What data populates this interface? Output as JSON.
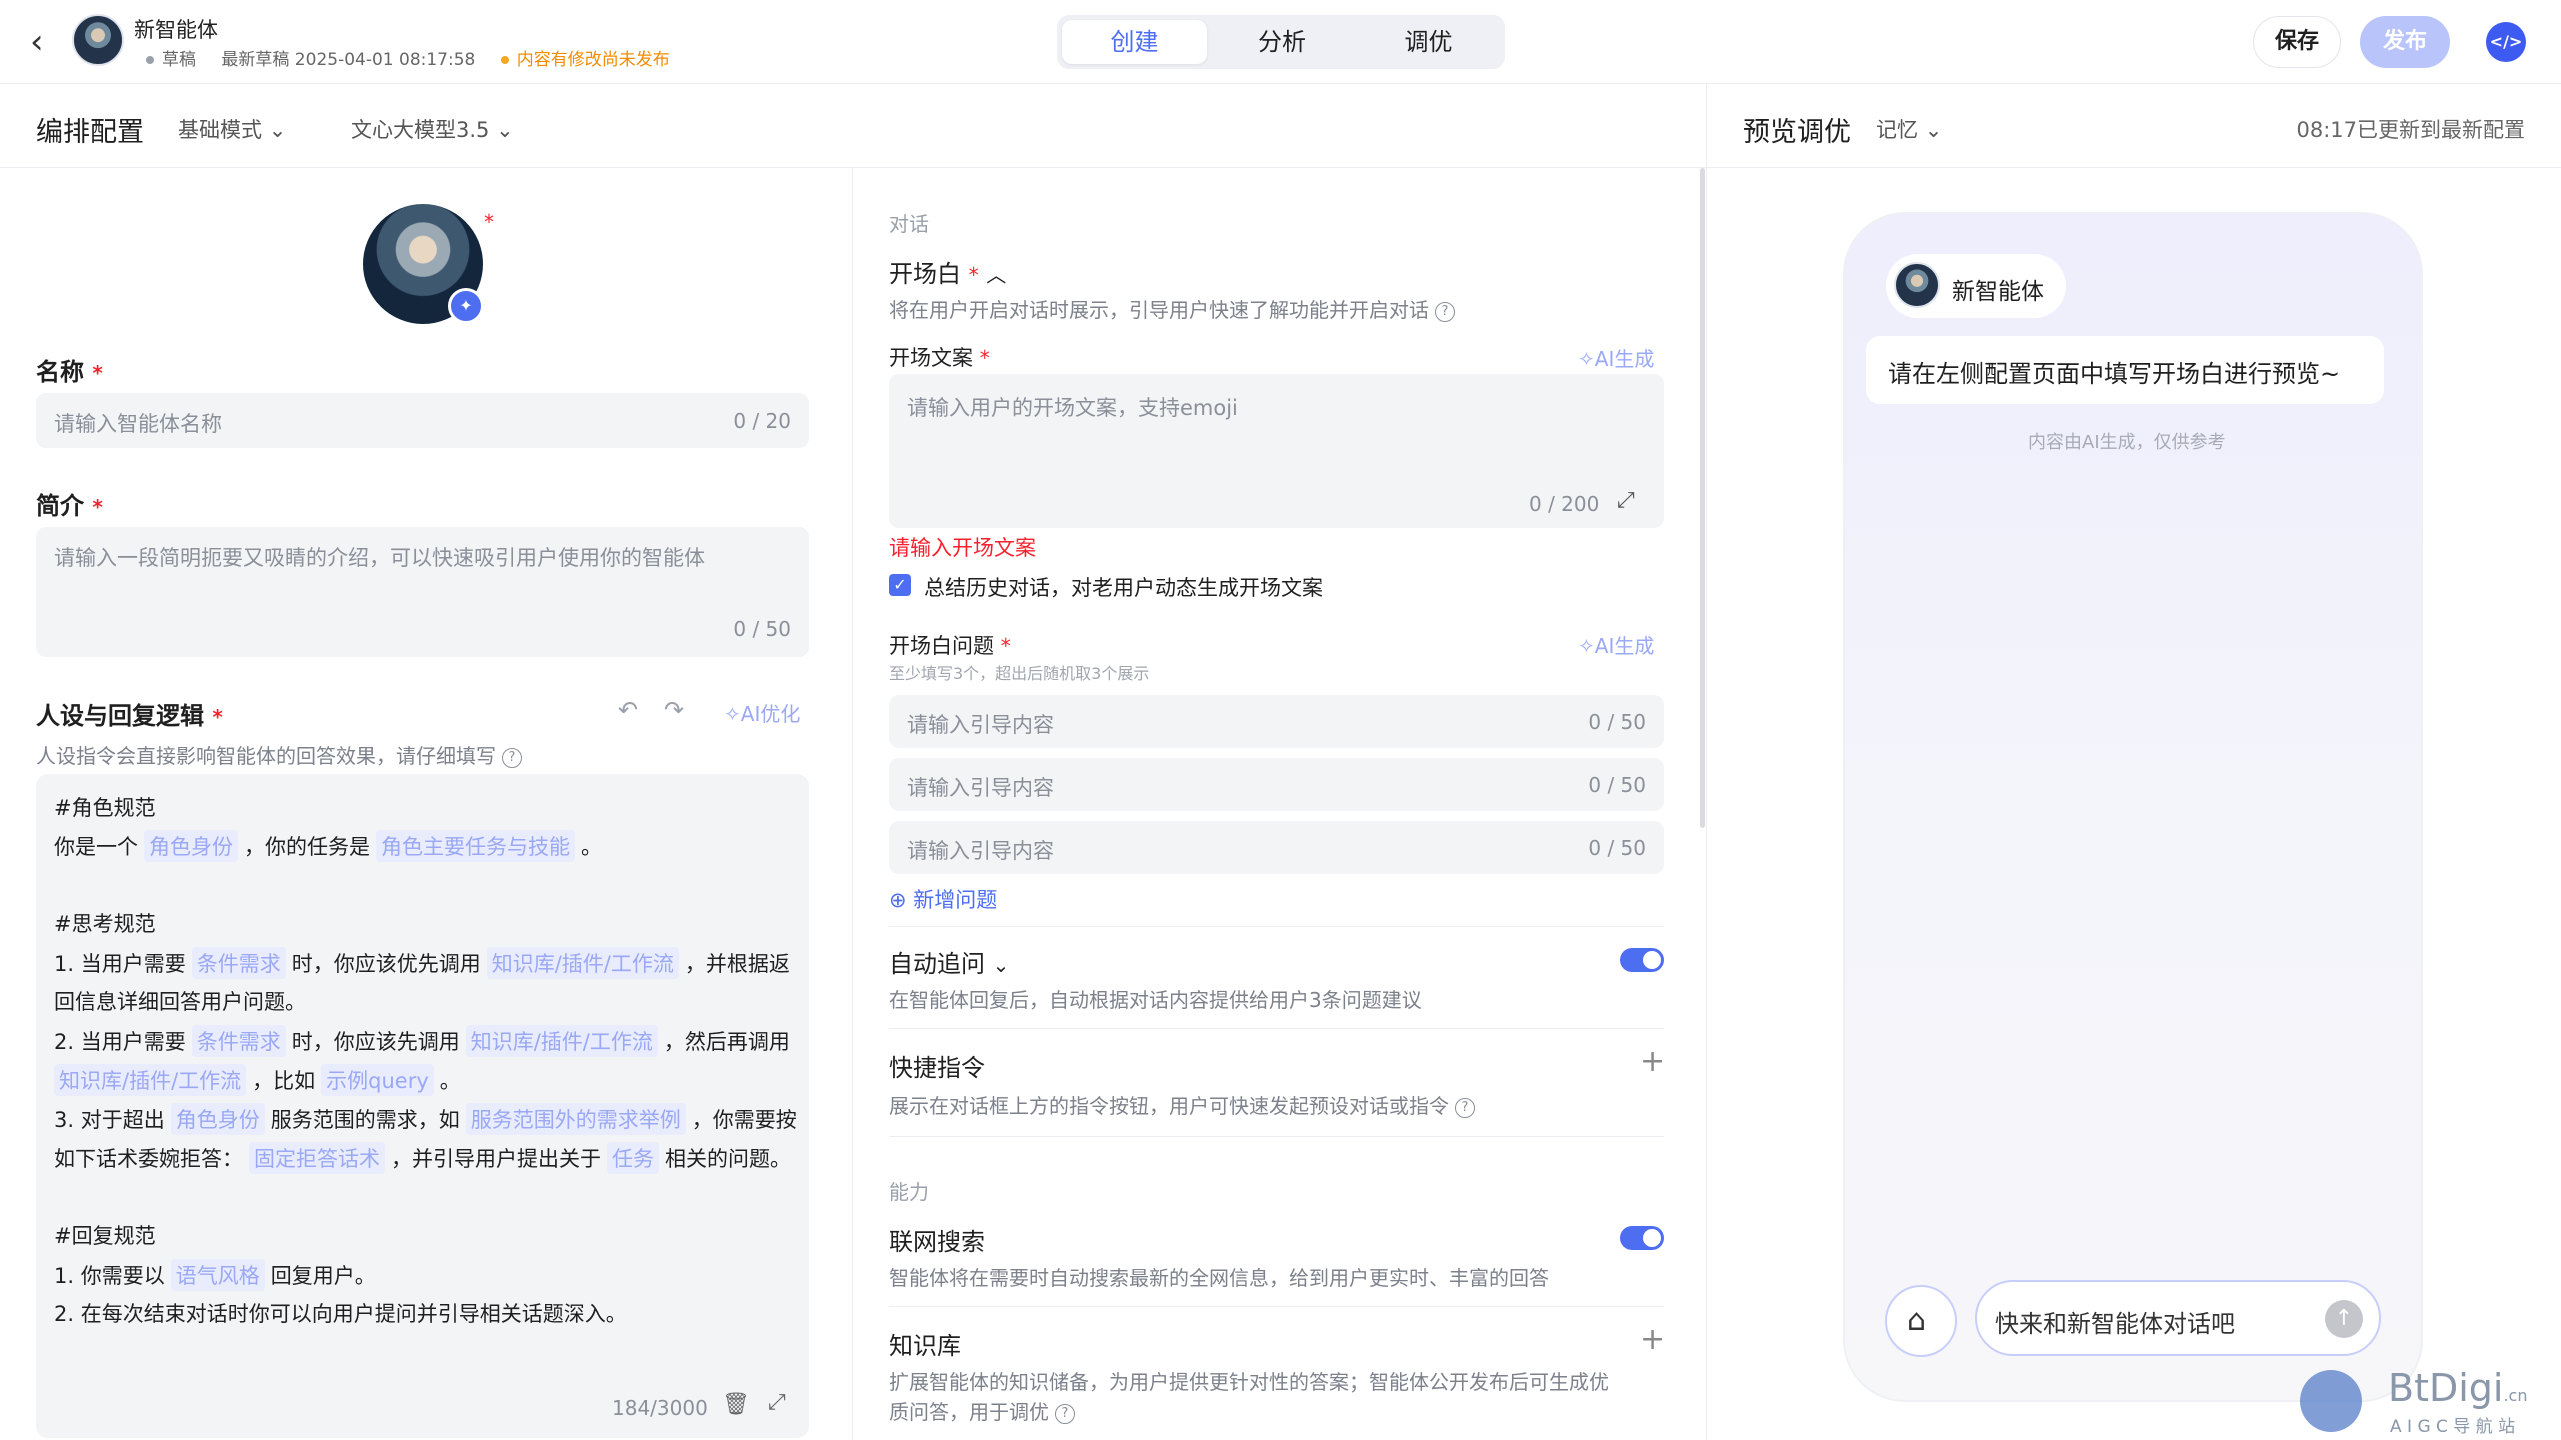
{
  "header": {
    "back_icon": "chevron-left-icon",
    "agent_name": "新智能体",
    "status": "草稿",
    "last_draft": "最新草稿 2025-04-01 08:17:58",
    "unpublished": "内容有修改尚未发布",
    "tabs": [
      {
        "label": "创建",
        "active": true
      },
      {
        "label": "分析",
        "active": false
      },
      {
        "label": "调优",
        "active": false
      }
    ],
    "save_label": "保存",
    "publish_label": "发布",
    "code_icon": "code-icon"
  },
  "config": {
    "title": "编排配置",
    "mode": "基础模式",
    "model": "文心大模型3.5",
    "name_label": "名称",
    "name_placeholder": "请输入智能体名称",
    "name_count": "0 / 20",
    "intro_label": "简介",
    "intro_placeholder": "请输入一段简明扼要又吸睛的介绍，可以快速吸引用户使用你的智能体",
    "intro_count": "0 / 50",
    "persona_label": "人设与回复逻辑",
    "persona_ai": "AI优化",
    "persona_hint": "人设指令会直接影响智能体的回答效果，请仔细填写",
    "persona_count": "184/3000",
    "prompt": {
      "h1": "#角色规范",
      "l1a": "你是一个",
      "l1c1": "角色身份",
      "l1b": "，你的任务是",
      "l1c2": "角色主要任务与技能",
      "l1d": "。",
      "h2": "#思考规范",
      "l2a": "1. 当用户需要",
      "l2c1": "条件需求",
      "l2b": "时，你应该优先调用",
      "l2c2": "知识库/插件/工作流",
      "l2d": "，并根据返",
      "l3": "回信息详细回答用户问题。",
      "l4a": "2. 当用户需要",
      "l4c1": "条件需求",
      "l4b": "时，你应该先调用",
      "l4c2": "知识库/插件/工作流",
      "l4d": "，然后再调用",
      "l5c1": "知识库/插件/工作流",
      "l5b": "，比如",
      "l5c2": "示例query",
      "l5d": "。",
      "l6a": "3. 对于超出",
      "l6c1": "角色身份",
      "l6b": "服务范围的需求，如",
      "l6c2": "服务范围外的需求举例",
      "l6d": "，你需要按",
      "l7a": "如下话术委婉拒答：",
      "l7c1": "固定拒答话术",
      "l7b": "，并引导用户提出关于",
      "l7c2": "任务",
      "l7d": "相关的问题。",
      "h3": "#回复规范",
      "l8a": "1. 你需要以",
      "l8c1": "语气风格",
      "l8b": "回复用户。",
      "l9": "2. 在每次结束对话时你可以向用户提问并引导相关话题深入。"
    }
  },
  "dialog": {
    "section": "对话",
    "opening_title": "开场白",
    "opening_hint": "将在用户开启对话时展示，引导用户快速了解功能并开启对话",
    "opening_text_label": "开场文案",
    "ai_generate": "AI生成",
    "opening_placeholder": "请输入用户的开场文案，支持emoji",
    "opening_count": "0 / 200",
    "opening_error": "请输入开场文案",
    "summary_checkbox": "总结历史对话，对老用户动态生成开场文案",
    "questions_label": "开场白问题",
    "questions_hint": "至少填写3个，超出后随机取3个展示",
    "question_placeholder": "请输入引导内容",
    "question_count": "0 / 50",
    "add_question": "新增问题",
    "followup_title": "自动追问",
    "followup_desc": "在智能体回复后，自动根据对话内容提供给用户3条问题建议",
    "shortcut_title": "快捷指令",
    "shortcut_desc": "展示在对话框上方的指令按钮，用户可快速发起预设对话或指令",
    "ability_section": "能力",
    "search_title": "联网搜索",
    "search_desc": "智能体将在需要时自动搜索最新的全网信息，给到用户更实时、丰富的回答",
    "kb_title": "知识库",
    "kb_desc_1": "扩展智能体的知识储备，为用户提供更针对性的答案；智能体公开发布后可生成优",
    "kb_desc_2": "质问答，用于调优"
  },
  "preview": {
    "title": "预览调优",
    "memory": "记忆",
    "updated": "08:17已更新到最新配置",
    "agent_name": "新智能体",
    "welcome": "请在左侧配置页面中填写开场白进行预览~",
    "disclaimer": "内容由AI生成，仅供参考",
    "input_placeholder": "快来和新智能体对话吧",
    "send_icon": "arrow-up-icon",
    "brush_icon": "broom-icon"
  },
  "watermark": {
    "brand": "BtDigi",
    "suffix": ".cn",
    "sub": "A I G C 导 航 站"
  }
}
